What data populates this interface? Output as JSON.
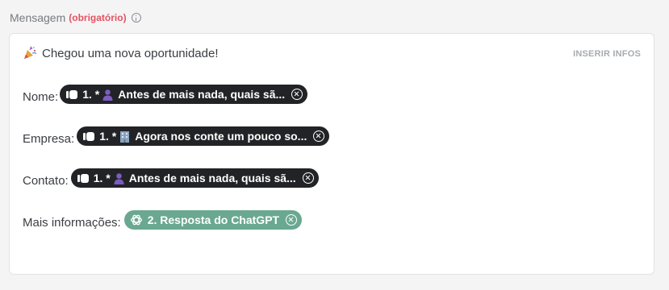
{
  "field": {
    "label": "Mensagem",
    "required_text": "(obrigatório)"
  },
  "editor": {
    "insert_button": "INSERIR INFOS",
    "first_line": "Chegou uma nova oportunidade!",
    "lines": [
      {
        "label": "Nome:",
        "chip_text": "1. *",
        "chip_tail": "Antes de mais nada, quais sã...",
        "chip_emoji": "person-silhouette-icon"
      },
      {
        "label": "Empresa:",
        "chip_text": "1. *",
        "chip_tail": "Agora nos conte um pouco so...",
        "chip_emoji": "office-building-icon"
      },
      {
        "label": "Contato:",
        "chip_text": "1. *",
        "chip_tail": "Antes de mais nada, quais sã...",
        "chip_emoji": "person-silhouette-icon"
      },
      {
        "label": "Mais informações:",
        "chip_text": "2. Resposta do ChatGPT",
        "chip_icon": "chatgpt-icon"
      }
    ]
  },
  "colors": {
    "required": "#e5525f",
    "chip_dark": "#222326",
    "chip_green": "#6aa891"
  }
}
